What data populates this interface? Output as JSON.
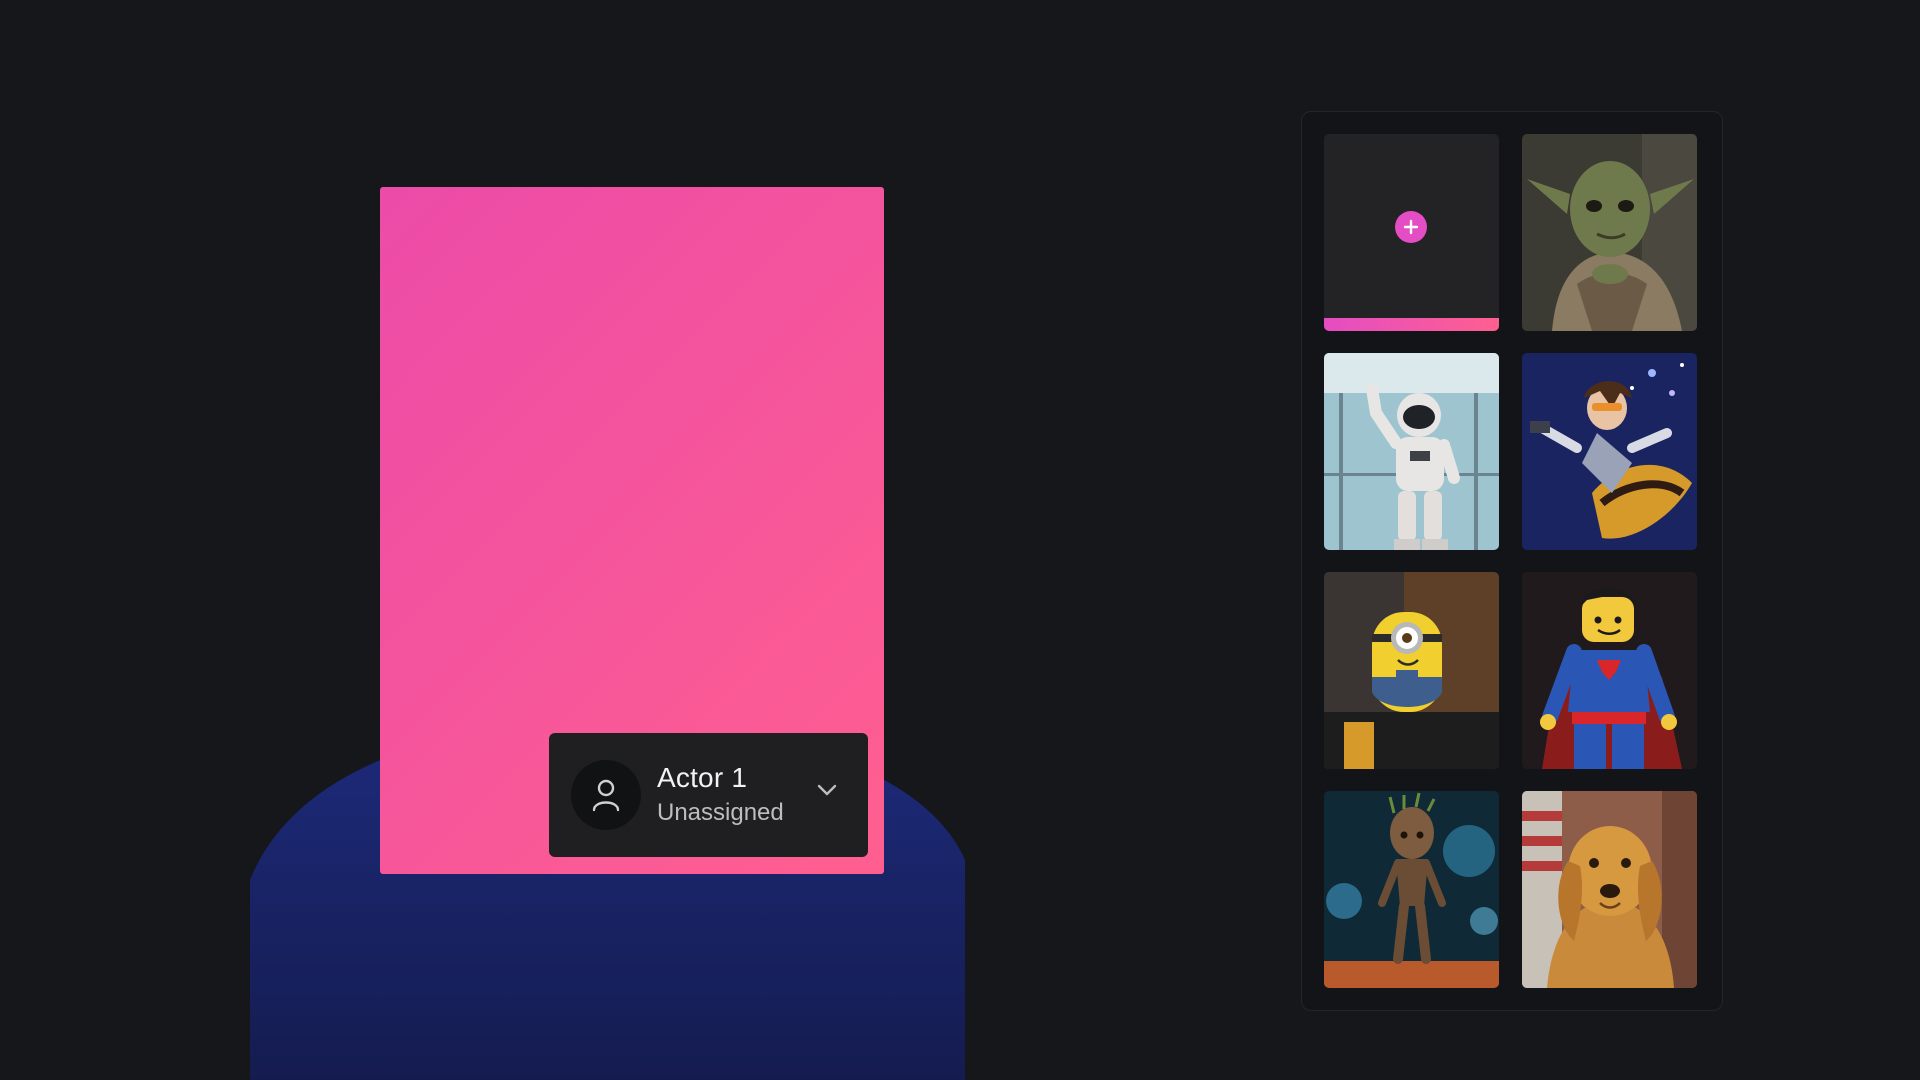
{
  "actor_card": {
    "name": "Actor 1",
    "status": "Unassigned",
    "avatar_icon": "user-icon",
    "dropdown_icon": "chevron-down-icon"
  },
  "gallery": {
    "add_tile_icon": "plus-icon",
    "tiles": [
      {
        "subject": "yoda-figure"
      },
      {
        "subject": "humanoid-robot"
      },
      {
        "subject": "tracer-figure"
      },
      {
        "subject": "minion-figure"
      },
      {
        "subject": "superman-lego-figure"
      },
      {
        "subject": "groot-figure"
      },
      {
        "subject": "golden-retriever"
      }
    ]
  },
  "colors": {
    "background": "#15171b",
    "accent_pink": "#e44dc3",
    "accent_coral": "#ff5f8f",
    "card": "#1f1f21"
  }
}
